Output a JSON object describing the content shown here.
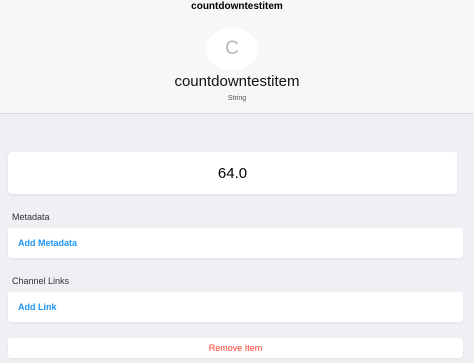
{
  "navbar": {
    "title": "countdowntestitem"
  },
  "header": {
    "avatar_letter": "C",
    "item_name": "countdowntestitem",
    "item_type": "String"
  },
  "state": {
    "value": "64.0"
  },
  "metadata": {
    "section_label": "Metadata",
    "add_label": "Add Metadata"
  },
  "channel_links": {
    "section_label": "Channel Links",
    "add_label": "Add Link"
  },
  "actions": {
    "remove_label": "Remove Item"
  },
  "colors": {
    "link": "#2196f3",
    "danger": "#ff3b30",
    "background": "#efeff4"
  }
}
